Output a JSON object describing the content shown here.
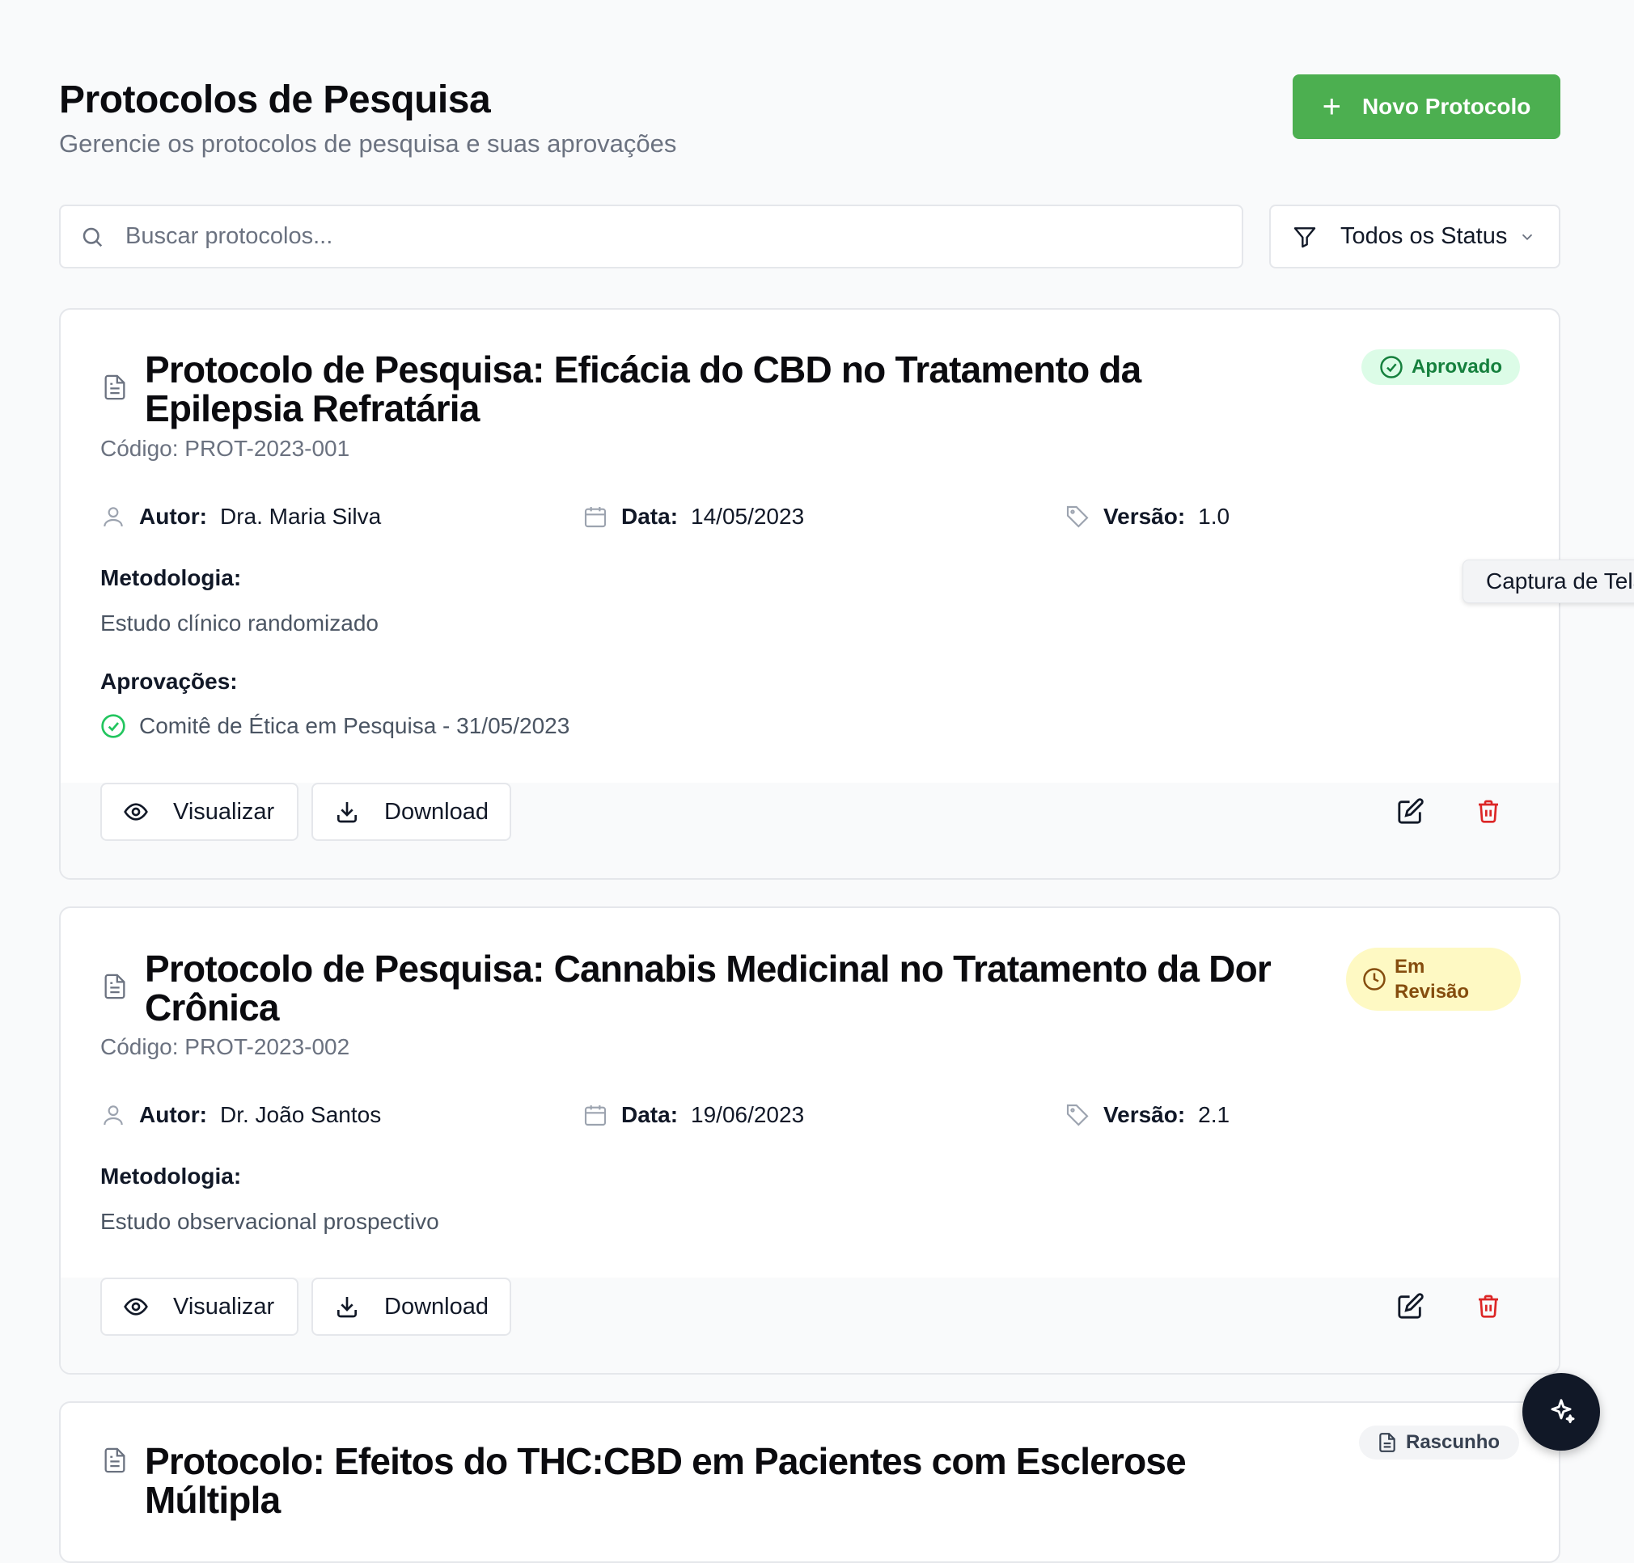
{
  "header": {
    "title": "Protocolos de Pesquisa",
    "subtitle": "Gerencie os protocolos de pesquisa e suas aprovações",
    "new_button": "Novo Protocolo"
  },
  "search": {
    "placeholder": "Buscar protocolos..."
  },
  "filter": {
    "label": "Todos os Status"
  },
  "labels": {
    "author": "Autor:",
    "date": "Data:",
    "version": "Versão:",
    "methodology": "Metodologia:",
    "approvals": "Aprovações:",
    "view": "Visualizar",
    "download": "Download"
  },
  "protocols": [
    {
      "title": "Protocolo de Pesquisa: Eficácia do CBD no Tratamento da Epilepsia Refratária",
      "code": "Código: PROT-2023-001",
      "status": "Aprovado",
      "author": "Dra. Maria Silva",
      "date": "14/05/2023",
      "version": "1.0",
      "methodology": "Estudo clínico randomizado",
      "approvals": [
        "Comitê de Ética em Pesquisa - 31/05/2023"
      ]
    },
    {
      "title": "Protocolo de Pesquisa: Cannabis Medicinal no Tratamento da Dor Crônica",
      "code": "Código: PROT-2023-002",
      "status_line1": "Em",
      "status_line2": "Revisão",
      "author": "Dr. João Santos",
      "date": "19/06/2023",
      "version": "2.1",
      "methodology": "Estudo observacional prospectivo"
    },
    {
      "title": "Protocolo: Efeitos do THC:CBD em Pacientes com Esclerose Múltipla",
      "status": "Rascunho"
    }
  ],
  "tooltip": "Captura de Tela",
  "colors": {
    "primary": "#4caf50",
    "danger": "#dc2626",
    "approved": "#15803d",
    "review": "#854d0e"
  }
}
